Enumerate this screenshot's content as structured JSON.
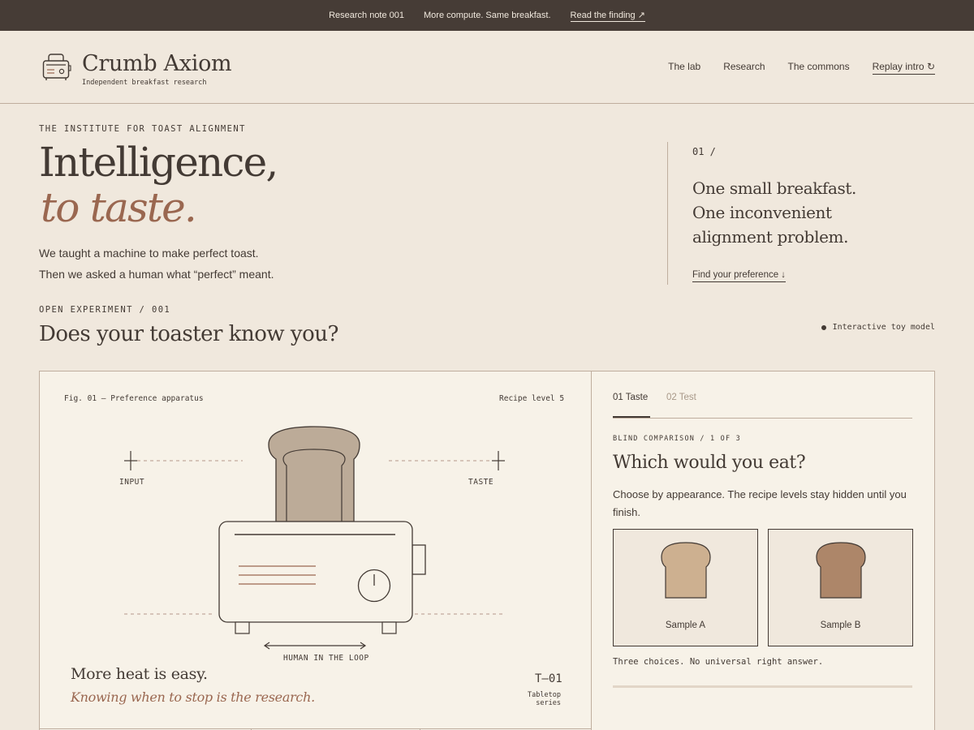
{
  "topbar": {
    "note": "Research note 001",
    "message": "More compute. Same breakfast.",
    "link": "Read the finding ↗"
  },
  "brand": {
    "name": "Crumb Axiom",
    "tagline": "Independent breakfast research"
  },
  "nav": {
    "items": [
      "The lab",
      "Research",
      "The commons"
    ],
    "replay": "Replay intro ↻"
  },
  "hero": {
    "eyebrow": "THE INSTITUTE FOR TOAST ALIGNMENT",
    "title": "Intelligence,",
    "title_accent": "to taste.",
    "sub_line1": "We taught a machine to make perfect toast.",
    "sub_line2": "Then we asked a human what “perfect” meant."
  },
  "side": {
    "number": "01 /",
    "quote_line1": "One small breakfast.",
    "quote_line2": "One inconvenient",
    "quote_line3": "alignment problem.",
    "link": "Find your preference ↓"
  },
  "experiment": {
    "eyebrow": "OPEN EXPERIMENT / 001",
    "title": "Does your toaster know you?",
    "badge": "Interactive toy model"
  },
  "figure": {
    "label": "Fig. 01 — Preference apparatus",
    "recipe_level": "Recipe level 5",
    "input_label": "INPUT",
    "taste_label": "TASTE",
    "loop_label": "HUMAN IN THE LOOP",
    "tagline": "More heat is easy.",
    "tagline_em": "Knowing when to stop is the research.",
    "series_code": "T—01",
    "series_name": "Tabletop series"
  },
  "comparison": {
    "tab_active": "01 Taste",
    "tab_inactive": "02 Test",
    "label": "BLIND COMPARISON / 1 OF 3",
    "question": "Which would you eat?",
    "instruction": "Choose by appearance. The recipe levels stay hidden until you finish.",
    "samples": [
      {
        "label": "Sample A",
        "color": "#cdb090"
      },
      {
        "label": "Sample B",
        "color": "#ad8669"
      }
    ],
    "footnote": "Three choices. No universal right answer.",
    "progress": 0
  },
  "colors": {
    "background": "#f0e8dd",
    "ink": "#433a34",
    "accent": "#9a6750",
    "topbar": "#463c36",
    "bread": "#bcab98"
  }
}
